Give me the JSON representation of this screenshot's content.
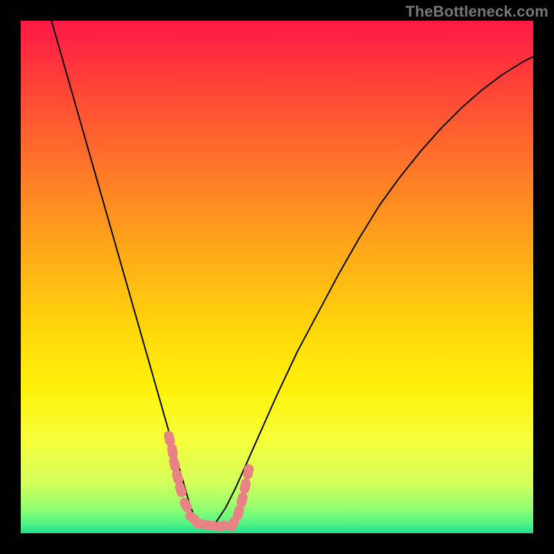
{
  "watermark": "TheBottleneck.com",
  "gradient": {
    "stops": [
      {
        "offset": 0.0,
        "color": "#ff1846"
      },
      {
        "offset": 0.1,
        "color": "#ff3a3a"
      },
      {
        "offset": 0.22,
        "color": "#ff612f"
      },
      {
        "offset": 0.35,
        "color": "#ff8a22"
      },
      {
        "offset": 0.48,
        "color": "#ffb215"
      },
      {
        "offset": 0.6,
        "color": "#ffd60a"
      },
      {
        "offset": 0.72,
        "color": "#fff20a"
      },
      {
        "offset": 0.82,
        "color": "#f5ff3a"
      },
      {
        "offset": 0.9,
        "color": "#d5ff5a"
      },
      {
        "offset": 0.95,
        "color": "#95ff70"
      },
      {
        "offset": 0.98,
        "color": "#55f585"
      },
      {
        "offset": 1.0,
        "color": "#1ee089"
      }
    ]
  },
  "chart_data": {
    "type": "line",
    "title": "",
    "xlabel": "",
    "ylabel": "",
    "xlim": [
      0,
      1
    ],
    "ylim": [
      0,
      1
    ],
    "series": [
      {
        "name": "curve",
        "color": "#000000",
        "x": [
          0.06,
          0.08,
          0.1,
          0.12,
          0.14,
          0.16,
          0.18,
          0.2,
          0.22,
          0.24,
          0.26,
          0.28,
          0.3,
          0.31,
          0.32,
          0.33,
          0.34,
          0.35,
          0.36,
          0.38,
          0.4,
          0.42,
          0.44,
          0.46,
          0.5,
          0.54,
          0.58,
          0.62,
          0.66,
          0.7,
          0.74,
          0.78,
          0.82,
          0.86,
          0.9,
          0.94,
          0.98,
          1.0
        ],
        "y": [
          1.0,
          0.93,
          0.86,
          0.79,
          0.72,
          0.65,
          0.58,
          0.51,
          0.44,
          0.37,
          0.3,
          0.23,
          0.16,
          0.125,
          0.09,
          0.055,
          0.03,
          0.015,
          0.01,
          0.02,
          0.05,
          0.09,
          0.135,
          0.18,
          0.27,
          0.355,
          0.43,
          0.505,
          0.575,
          0.64,
          0.695,
          0.745,
          0.79,
          0.83,
          0.865,
          0.895,
          0.92,
          0.93
        ]
      },
      {
        "name": "marker-cluster",
        "color": "#e98285",
        "marker": "capsule",
        "points": [
          {
            "x": 0.29,
            "y": 0.185
          },
          {
            "x": 0.296,
            "y": 0.16
          },
          {
            "x": 0.3,
            "y": 0.135
          },
          {
            "x": 0.306,
            "y": 0.11
          },
          {
            "x": 0.312,
            "y": 0.085
          },
          {
            "x": 0.322,
            "y": 0.055
          },
          {
            "x": 0.335,
            "y": 0.03
          },
          {
            "x": 0.35,
            "y": 0.018
          },
          {
            "x": 0.37,
            "y": 0.015
          },
          {
            "x": 0.392,
            "y": 0.014
          },
          {
            "x": 0.414,
            "y": 0.018
          },
          {
            "x": 0.425,
            "y": 0.04
          },
          {
            "x": 0.432,
            "y": 0.065
          },
          {
            "x": 0.438,
            "y": 0.092
          },
          {
            "x": 0.444,
            "y": 0.12
          }
        ]
      }
    ]
  }
}
